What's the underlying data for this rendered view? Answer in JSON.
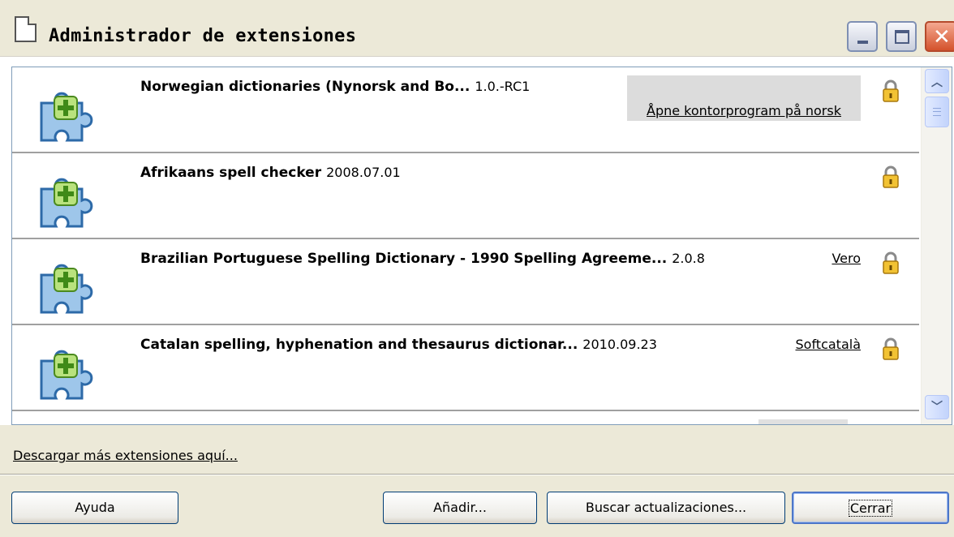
{
  "window": {
    "title": "Administrador de extensiones",
    "minimize_icon": "minimize-icon",
    "maximize_icon": "maximize-icon",
    "close_icon": "close-icon"
  },
  "extensions": [
    {
      "name": "Norwegian dictionaries (Nynorsk and Bo...",
      "version": "1.0.-RC1",
      "publisher": "Åpne kontorprogram på norsk",
      "icon": "puzzle-piece-icon",
      "status_icon": "lock-icon"
    },
    {
      "name": "Afrikaans spell checker",
      "version": "2008.07.01",
      "publisher": "",
      "icon": "puzzle-piece-icon",
      "status_icon": "lock-icon"
    },
    {
      "name": "Brazilian Portuguese Spelling Dictionary - 1990 Spelling Agreeme...",
      "version": "2.0.8",
      "publisher": "Vero",
      "icon": "puzzle-piece-icon",
      "status_icon": "lock-icon"
    },
    {
      "name": "Catalan spelling, hyphenation and thesaurus dictionar...",
      "version": "2010.09.23",
      "publisher": "Softcatalà",
      "icon": "puzzle-piece-icon",
      "status_icon": "lock-icon"
    }
  ],
  "footer": {
    "more_link": "Descargar más extensiones aquí...",
    "help_button": "Ayuda",
    "add_button": "Añadir...",
    "updates_button": "Buscar actualizaciones...",
    "close_button": "Cerrar"
  },
  "colors": {
    "dialog_bg": "#ece9d8",
    "list_border": "#7f9db9",
    "close_red": "#d4522c",
    "default_button_border": "#4d76c8"
  }
}
